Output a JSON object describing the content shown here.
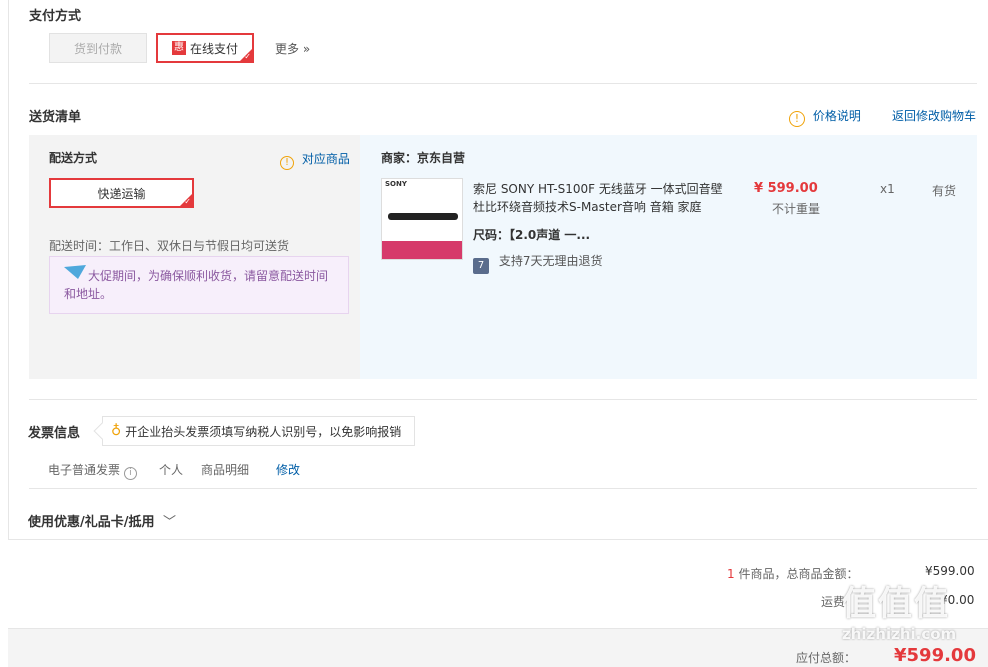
{
  "payment": {
    "title": "支付方式",
    "cod_label": "货到付款",
    "online_badge": "惠",
    "online_label": "在线支付",
    "more_label": "更多 »"
  },
  "shipping": {
    "title": "送货清单",
    "price_info": "价格说明",
    "back_to_cart": "返回修改购物车",
    "method_title": "配送方式",
    "matching_products": "对应商品",
    "express_label": "快递运输",
    "delivery_time": "配送时间：工作日、双休日与节假日均可送货",
    "promo_notice": "大促期间，为确保顺利收货，请留意配送时间和地址。",
    "seller": "商家：京东自营",
    "product": {
      "thumb_brand": "SONY",
      "name": "索尼 SONY HT-S100F 无线蓝牙 一体式回音壁 杜比环绕音频技术S-Master音响 音箱 家庭",
      "size": "尺码：【2.0声道 一...",
      "return_badge": "7",
      "return_policy": "支持7天无理由退货",
      "price": "¥ 599.00",
      "weight": "不计重量",
      "qty": "x1",
      "stock": "有货"
    }
  },
  "invoice": {
    "title": "发票信息",
    "tip": "开企业抬头发票须填写纳税人识别号，以免影响报销",
    "type": "电子普通发票",
    "holder": "个人",
    "content": "商品明细",
    "edit": "修改"
  },
  "coupon": {
    "title": "使用优惠/礼品卡/抵用"
  },
  "summary": {
    "count": "1",
    "count_suffix": "件商品，总商品金额：",
    "goods_total": "¥599.00",
    "freight_label": "运费：",
    "freight": "¥0.00",
    "payable_label": "应付总额：",
    "payable": "¥599.00"
  },
  "watermark": {
    "text": "zhizhizhi.com",
    "glyphs": "值值值"
  },
  "colors": {
    "accent": "#e4393c",
    "link": "#005ea7",
    "notice_text": "#8b59a0",
    "warning": "#f0a30a"
  }
}
